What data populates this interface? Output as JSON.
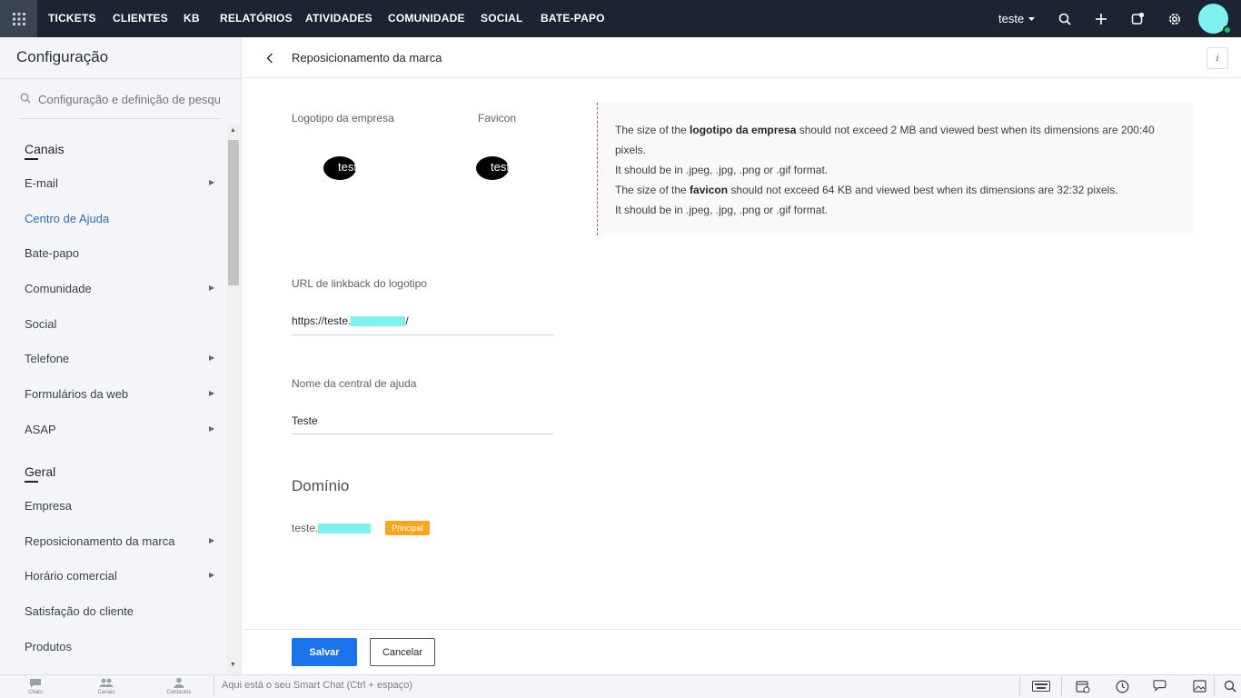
{
  "topnav": {
    "items": [
      "TICKETS",
      "CLIENTES",
      "KB",
      "RELATÓRIOS",
      "ATIVIDADES",
      "COMUNIDADE",
      "SOCIAL",
      "BATE-PAPO"
    ],
    "portal_name": "teste"
  },
  "sidebar": {
    "title": "Configuração",
    "search_placeholder": "Configuração e definição de pesqui",
    "section_channels": "Canais",
    "channels": [
      {
        "label": "E-mail",
        "has_arrow": true
      },
      {
        "label": "Centro de Ajuda",
        "has_arrow": false,
        "active": true
      },
      {
        "label": "Bate-papo",
        "has_arrow": false
      },
      {
        "label": "Comunidade",
        "has_arrow": true
      },
      {
        "label": "Social",
        "has_arrow": false
      },
      {
        "label": "Telefone",
        "has_arrow": true
      },
      {
        "label": "Formulários da web",
        "has_arrow": true
      },
      {
        "label": "ASAP",
        "has_arrow": true
      }
    ],
    "section_general": "Geral",
    "general": [
      {
        "label": "Empresa",
        "has_arrow": false
      },
      {
        "label": "Reposicionamento da marca",
        "has_arrow": true
      },
      {
        "label": "Horário comercial",
        "has_arrow": true
      },
      {
        "label": "Satisfação do cliente",
        "has_arrow": false
      },
      {
        "label": "Produtos",
        "has_arrow": false
      }
    ]
  },
  "header": {
    "title": "Reposicionamento da marca",
    "info_label": "i"
  },
  "branding": {
    "company_logo_label": "Logotipo da empresa",
    "company_logo_text": "teste",
    "favicon_label": "Favicon",
    "favicon_text": "teste",
    "info": {
      "line1_pre": "The size of the ",
      "line1_bold": "logotipo da empresa",
      "line1_post": " should not exceed 2 MB and viewed best when its dimensions are 200:40",
      "line1_cont": "pixels.",
      "line2": "It should be in .jpeg, .jpg, .png or .gif format.",
      "line3_pre": "The size of the ",
      "line3_bold": "favicon",
      "line3_post": " should not exceed 64 KB and viewed best when its dimensions are 32:32 pixels.",
      "line4": "It should be in .jpeg, .jpg, .png or .gif format."
    }
  },
  "form": {
    "linkback_label": "URL de linkback do logotipo",
    "linkback_prefix": "https://teste.",
    "linkback_suffix": "/",
    "helpcenter_name_label": "Nome da central de ajuda",
    "helpcenter_name_value": "Teste"
  },
  "domain": {
    "title": "Domínio",
    "prefix": "teste.",
    "badge": "Principal"
  },
  "actions": {
    "save": "Salvar",
    "cancel": "Cancelar"
  },
  "bottombar": {
    "tabs": [
      "Chats",
      "Canais",
      "Contactos"
    ],
    "smartchat_placeholder": "Aqui está o seu Smart Chat (Ctrl + espaço)"
  },
  "colors": {
    "topbar": "#1c2432",
    "accent": "#1a73e8",
    "active_link": "#2f6bb5",
    "badge": "#f5a623",
    "avatar": "#7ef0ee"
  }
}
